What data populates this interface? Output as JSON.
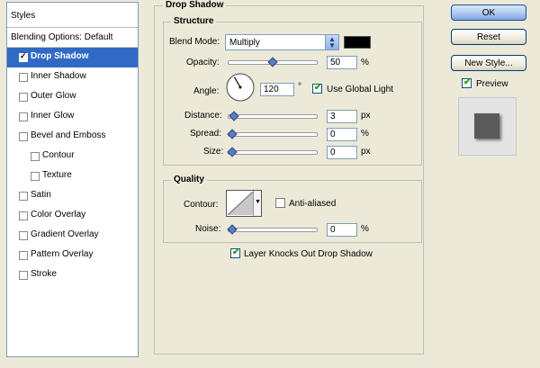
{
  "styles_panel": {
    "header": "Styles",
    "blending_options": "Blending Options: Default",
    "items": [
      {
        "label": "Drop Shadow",
        "checked": true,
        "selected": true,
        "indent": false
      },
      {
        "label": "Inner Shadow",
        "checked": false,
        "selected": false,
        "indent": false
      },
      {
        "label": "Outer Glow",
        "checked": false,
        "selected": false,
        "indent": false
      },
      {
        "label": "Inner Glow",
        "checked": false,
        "selected": false,
        "indent": false
      },
      {
        "label": "Bevel and Emboss",
        "checked": false,
        "selected": false,
        "indent": false
      },
      {
        "label": "Contour",
        "checked": false,
        "selected": false,
        "indent": true
      },
      {
        "label": "Texture",
        "checked": false,
        "selected": false,
        "indent": true
      },
      {
        "label": "Satin",
        "checked": false,
        "selected": false,
        "indent": false
      },
      {
        "label": "Color Overlay",
        "checked": false,
        "selected": false,
        "indent": false
      },
      {
        "label": "Gradient Overlay",
        "checked": false,
        "selected": false,
        "indent": false
      },
      {
        "label": "Pattern Overlay",
        "checked": false,
        "selected": false,
        "indent": false
      },
      {
        "label": "Stroke",
        "checked": false,
        "selected": false,
        "indent": false
      }
    ]
  },
  "drop_shadow": {
    "title": "Drop Shadow",
    "structure": {
      "title": "Structure",
      "blend_mode_label": "Blend Mode:",
      "blend_mode_value": "Multiply",
      "shadow_color": "#000000",
      "opacity_label": "Opacity:",
      "opacity_value": "50",
      "opacity_unit": "%",
      "opacity_slider": 0.5,
      "angle_label": "Angle:",
      "angle_value": "120",
      "angle_unit": "°",
      "angle_degrees": 120,
      "use_global_light_label": "Use Global Light",
      "use_global_light_checked": true,
      "distance_label": "Distance:",
      "distance_value": "3",
      "distance_unit": "px",
      "distance_slider": 0.02,
      "spread_label": "Spread:",
      "spread_value": "0",
      "spread_unit": "%",
      "spread_slider": 0,
      "size_label": "Size:",
      "size_value": "0",
      "size_unit": "px",
      "size_slider": 0
    },
    "quality": {
      "title": "Quality",
      "contour_label": "Contour:",
      "anti_aliased_label": "Anti-aliased",
      "anti_aliased_checked": false,
      "noise_label": "Noise:",
      "noise_value": "0",
      "noise_unit": "%",
      "noise_slider": 0
    },
    "layer_knocks_out_label": "Layer Knocks Out Drop Shadow",
    "layer_knocks_out_checked": true
  },
  "buttons": {
    "ok": "OK",
    "reset": "Reset",
    "new_style": "New Style...",
    "preview_label": "Preview",
    "preview_checked": true
  },
  "colors": {
    "selection": "#316ac5",
    "dialog_bg": "#ece9d8",
    "preview_square": "#5a5a5a"
  }
}
